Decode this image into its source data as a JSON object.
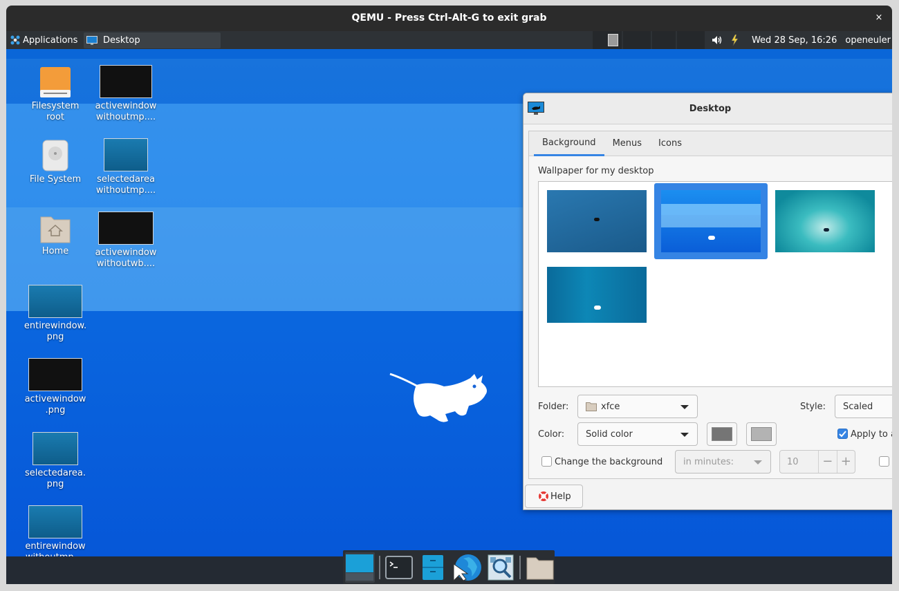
{
  "qemu": {
    "title": "QEMU - Press Ctrl-Alt-G to exit grab",
    "close_glyph": "×"
  },
  "panel": {
    "applications_label": "Applications",
    "task_label": "Desktop",
    "clock": "Wed 28 Sep, 16:26",
    "user": "openeuler"
  },
  "desktop_icons": [
    {
      "label": "Filesystem\nroot"
    },
    {
      "label": "activewindow\nwithoutmp...."
    },
    {
      "label": "File System"
    },
    {
      "label": "selectedarea\nwithoutmp...."
    },
    {
      "label": "Home"
    },
    {
      "label": "activewindow\nwithoutwb...."
    },
    {
      "label": "entirewindow.\npng"
    },
    {
      "label": "activewindow\n.png"
    },
    {
      "label": "selectedarea.\npng"
    },
    {
      "label": "entirewindow\nwithoutmp...."
    }
  ],
  "dialog": {
    "title": "Desktop",
    "tabs": [
      "Background",
      "Menus",
      "Icons"
    ],
    "active_tab": "Background",
    "wallpaper_label": "Wallpaper for my desktop",
    "selected_wallpaper_index": 1,
    "folder_label": "Folder:",
    "folder_value": "xfce",
    "style_label": "Style:",
    "style_value": "Scaled",
    "color_label": "Color:",
    "color_value": "Solid color",
    "color1": "#757575",
    "color2": "#b3b3b3",
    "apply_label": "Apply to a",
    "apply_checked": true,
    "change_bg_label": "Change the background",
    "change_bg_checked": false,
    "interval_unit": "in minutes:",
    "interval_value": "10",
    "help_label": "Help"
  },
  "colors": {
    "accent": "#3584e4",
    "panel": "#2e3236",
    "desktop": "#0a66d8"
  }
}
